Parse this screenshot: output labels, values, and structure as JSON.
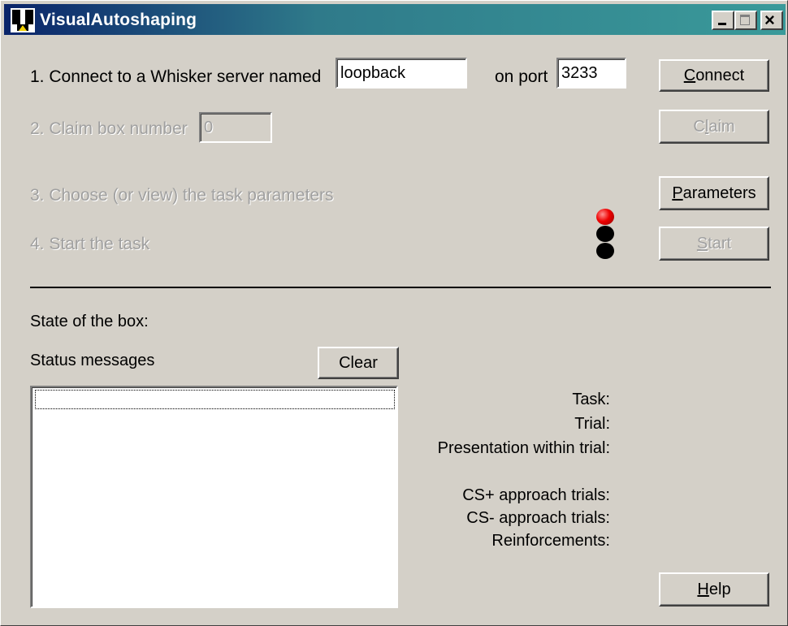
{
  "window": {
    "title": "VisualAutoshaping",
    "icon": "whisker-app-icon",
    "controls": [
      "minimize-icon",
      "maximize-icon",
      "close-icon"
    ]
  },
  "step1": {
    "label": "1. Connect to a Whisker server named",
    "server_value": "loopback",
    "port_label": "on port",
    "port_value": "3233",
    "connect_prefix": "",
    "connect_accel": "C",
    "connect_rest": "onnect"
  },
  "step2": {
    "label": "2. Claim box number",
    "box_value": "0",
    "claim_prefix": "C",
    "claim_accel": "l",
    "claim_rest": "aim"
  },
  "step3": {
    "label": "3. Choose (or view) the task parameters",
    "parameters_accel": "P",
    "parameters_rest": "arameters"
  },
  "step4": {
    "label": "4. Start the task",
    "start_accel": "S",
    "start_rest": "tart",
    "traffic_light_colors": [
      "#dd0000",
      "#000000",
      "#000000"
    ]
  },
  "state": {
    "heading": "State of the box:",
    "status_messages_label": "Status messages",
    "clear_label": "Clear",
    "status_messages": []
  },
  "info": {
    "task": "Task:",
    "trial": "Trial:",
    "presentation": "Presentation within trial:",
    "cs_plus": "CS+ approach trials:",
    "cs_minus": "CS- approach trials:",
    "reinforcements": "Reinforcements:"
  },
  "help": {
    "accel": "H",
    "rest": "elp"
  },
  "colors": {
    "face": "#d4d0c8",
    "disabled_text": "#a0a0a0",
    "title_gradient_start": "#0a246a",
    "title_gradient_end": "#3a9a9a"
  }
}
